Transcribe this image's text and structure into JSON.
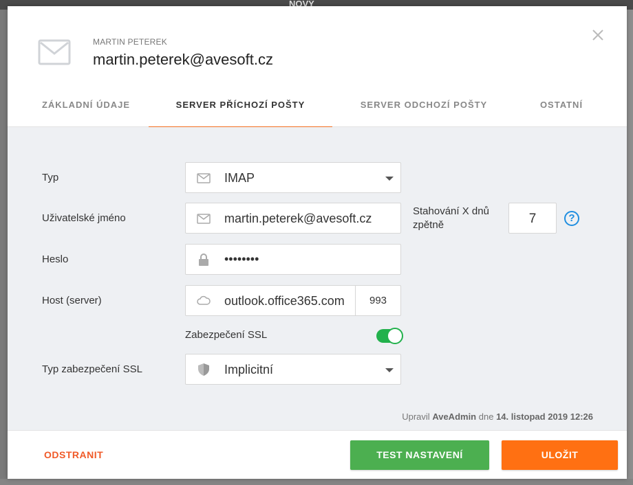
{
  "backdrop": {
    "nav_fragment": "NOVÝ"
  },
  "header": {
    "pre_title": "MARTIN PETEREK",
    "title": "martin.peterek@avesoft.cz"
  },
  "tabs": [
    {
      "label": "ZÁKLADNÍ ÚDAJE"
    },
    {
      "label": "SERVER PŘÍCHOZÍ POŠTY",
      "active": true
    },
    {
      "label": "SERVER ODCHOZÍ POŠTY"
    },
    {
      "label": "OSTATNÍ"
    }
  ],
  "form": {
    "type": {
      "label": "Typ",
      "value": "IMAP",
      "icon": "mail-icon"
    },
    "username": {
      "label": "Uživatelské jméno",
      "value": "martin.peterek@avesoft.cz",
      "icon": "mail-icon"
    },
    "password": {
      "label": "Heslo",
      "value": "••••••••",
      "icon": "lock-icon"
    },
    "host": {
      "label": "Host (server)",
      "value": "outlook.office365.com",
      "port": "993",
      "icon": "cloud-icon"
    },
    "ssl": {
      "label": "Zabezpečení SSL",
      "enabled": true
    },
    "ssl_type": {
      "label": "Typ zabezpečení SSL",
      "value": "Implicitní",
      "icon": "shield-icon"
    },
    "download_days": {
      "label": "Stahování X dnů zpětně",
      "value": "7",
      "help": "?"
    }
  },
  "edit_info": {
    "prefix": "Upravil",
    "user": "AveAdmin",
    "middle": "dne",
    "date": "14. listopad 2019 12:26"
  },
  "footer": {
    "delete_label": "ODSTRANIT",
    "test_label": "TEST NASTAVENÍ",
    "save_label": "ULOŽIT"
  },
  "colors": {
    "accent": "#f36f21",
    "save": "#ff7012",
    "test": "#4caf50",
    "toggle_on": "#22b14c",
    "help": "#1f8ee0"
  }
}
